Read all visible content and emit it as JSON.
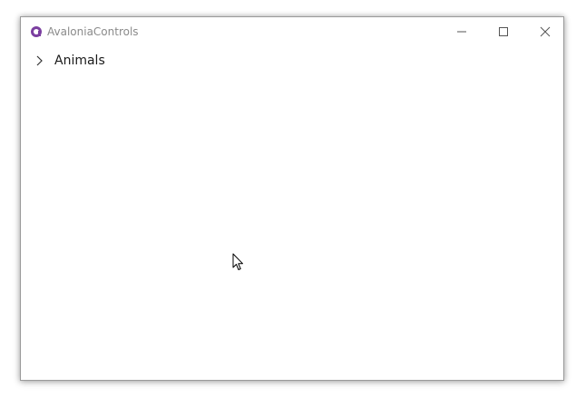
{
  "window": {
    "title": "AvaloniaControls",
    "icon": "avalonia-logo-icon",
    "controls": {
      "minimize": "minimize-icon",
      "maximize": "maximize-icon",
      "close": "close-icon"
    }
  },
  "tree": {
    "items": [
      {
        "label": "Animals",
        "expanded": false,
        "icon": "chevron-right-icon"
      }
    ]
  },
  "colors": {
    "accent": "#7b3fa0",
    "title_text": "#8a8a8a",
    "item_text": "#1a1a1a"
  }
}
